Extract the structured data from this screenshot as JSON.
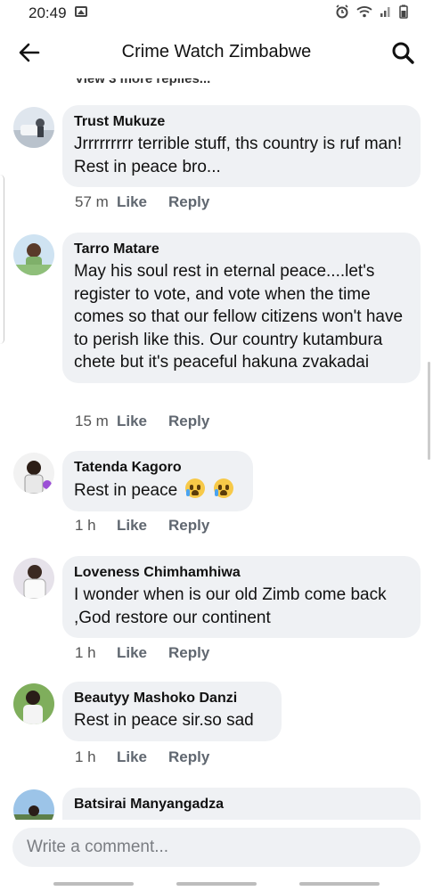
{
  "status_bar": {
    "time": "20:49",
    "icons": [
      "gallery-icon",
      "alarm-icon",
      "wifi-icon",
      "signal-icon",
      "battery-icon"
    ]
  },
  "header": {
    "title": "Crime Watch Zimbabwe",
    "back_icon": "arrow-left-icon",
    "search_icon": "search-icon"
  },
  "view_more": "View 3 more replies...",
  "comments": [
    {
      "author": "Trust Mukuze",
      "text": "Jrrrrrrrrr terrible stuff, ths country is ruf man! Rest in peace bro...",
      "time": "57 m",
      "like": "Like",
      "reply": "Reply"
    },
    {
      "author": "Tarro Matare",
      "text": "May his soul rest in eternal peace....let's register to vote, and vote when the time comes so that our fellow citizens won't have to perish like this. Our country kutambura chete but it's peaceful hakuna zvakadai",
      "time": "15 m",
      "like": "Like",
      "reply": "Reply"
    },
    {
      "author": "Tatenda Kagoro",
      "text": "Rest in peace",
      "emoji": "loudly-crying-face-emoji",
      "time": "1 h",
      "like": "Like",
      "reply": "Reply"
    },
    {
      "author": "Loveness Chimhamhiwa",
      "text": "I wonder when is our old Zimb come back ,God restore our continent",
      "time": "1 h",
      "like": "Like",
      "reply": "Reply"
    },
    {
      "author": "Beautyy Mashoko Danzi",
      "text": "Rest in peace sir.so sad",
      "time": "1 h",
      "like": "Like",
      "reply": "Reply"
    },
    {
      "author": "Batsirai Manyangadza",
      "text": ""
    }
  ],
  "composer": {
    "placeholder": "Write a comment..."
  },
  "colors": {
    "bubble": "#eff1f4",
    "action_text": "#606770",
    "background": "#ffffff"
  }
}
